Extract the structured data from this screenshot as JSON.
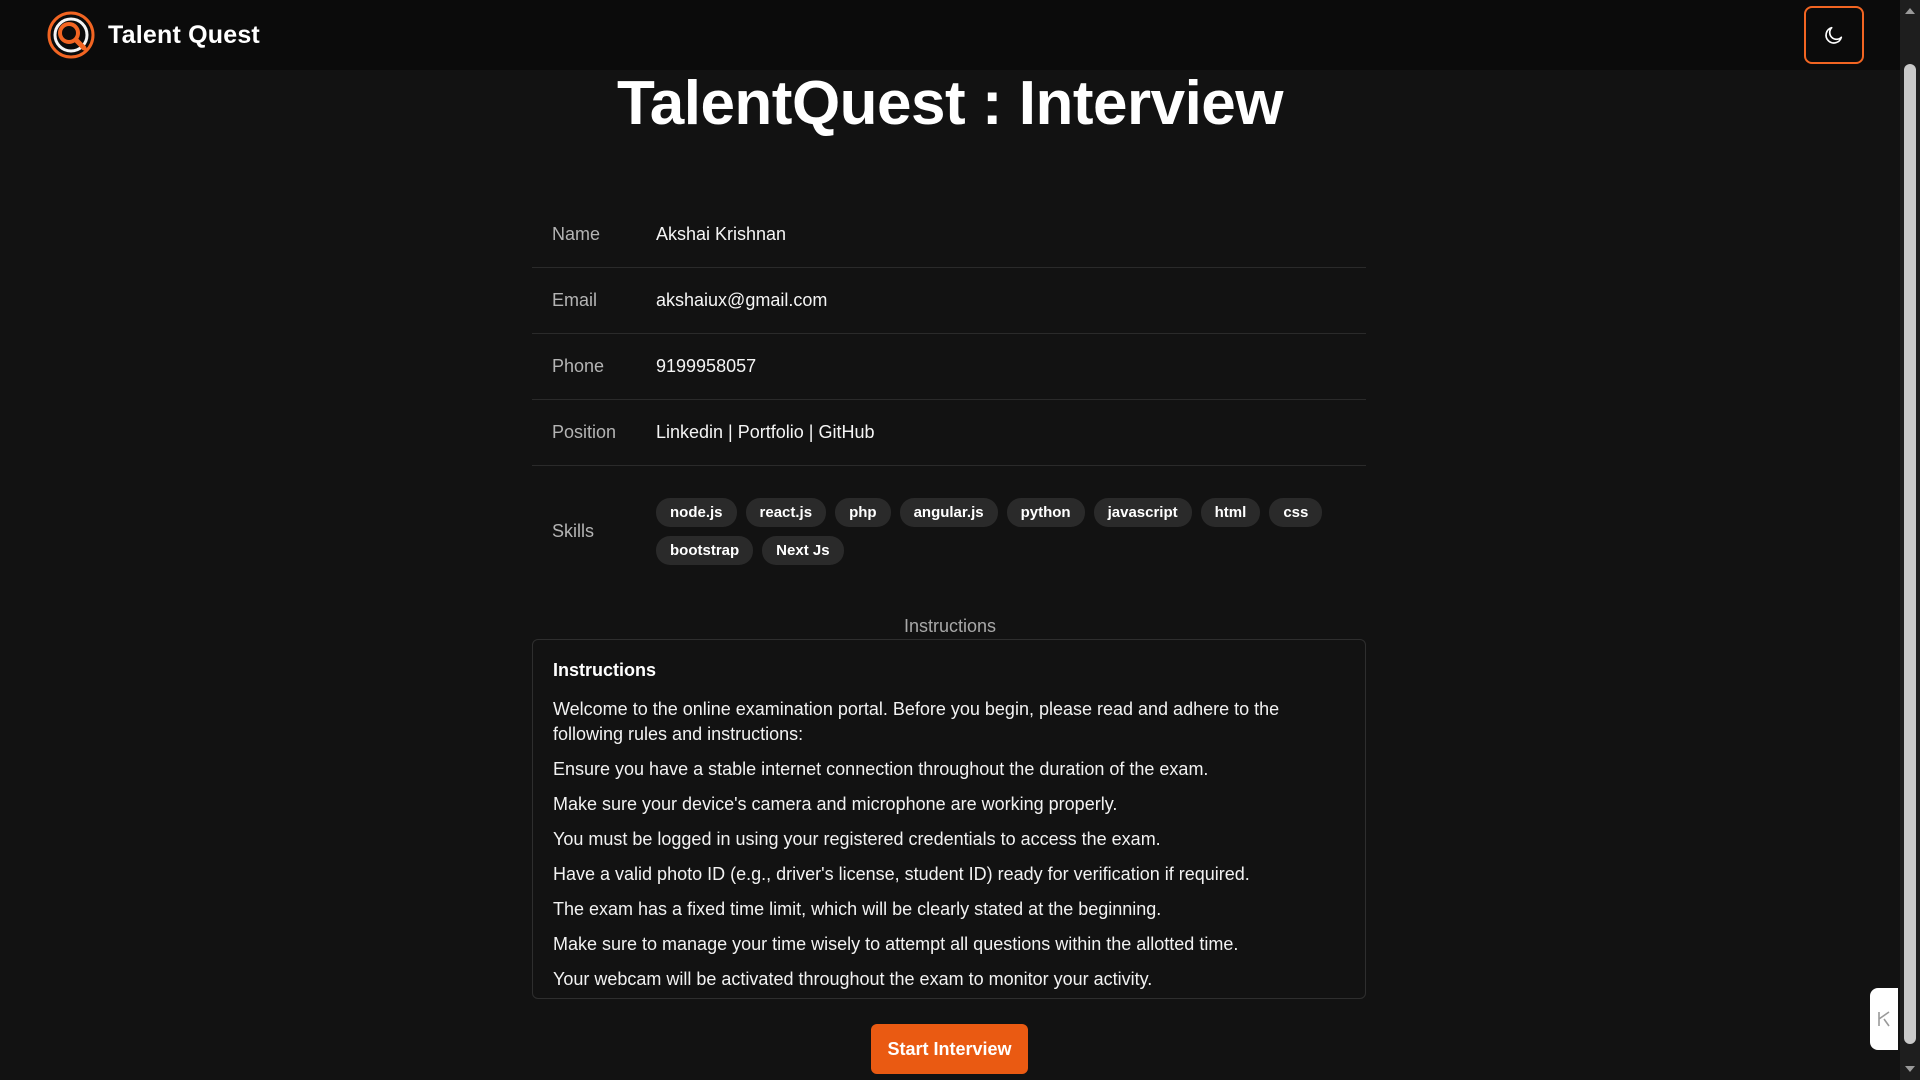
{
  "app": {
    "brand_name": "Talent Quest",
    "title": "TalentQuest : Interview"
  },
  "header": {
    "theme_toggle_icon": "moon-icon"
  },
  "details": {
    "name_label": "Name",
    "name_value": "Akshai Krishnan",
    "email_label": "Email",
    "email_value": "akshaiux@gmail.com",
    "phone_label": "Phone",
    "phone_value": "9199958057",
    "position_label": "Position",
    "position_value": "Linkedin | Portfolio | GitHub",
    "skills_label": "Skills",
    "skills": [
      "node.js",
      "react.js",
      "php",
      "angular.js",
      "python",
      "javascript",
      "html",
      "css",
      "bootstrap",
      "Next Js"
    ]
  },
  "instructions": {
    "caption": "Instructions",
    "heading": "Instructions",
    "intro": "Welcome to the online examination portal. Before you begin, please read and adhere to the following rules and instructions:",
    "lines": [
      "Ensure you have a stable internet connection throughout the duration of the exam.",
      "Make sure your device's camera and microphone are working properly.",
      "You must be logged in using your registered credentials to access the exam.",
      "Have a valid photo ID (e.g., driver's license, student ID) ready for verification if required.",
      "The exam has a fixed time limit, which will be clearly stated at the beginning.",
      "Make sure to manage your time wisely to attempt all questions within the allotted time.",
      "Your webcam will be activated throughout the exam to monitor your activity."
    ]
  },
  "actions": {
    "start_label": "Start Interview"
  },
  "colors": {
    "accent": "#ea5a12",
    "background": "#121212",
    "header": "#0b0b0b"
  }
}
